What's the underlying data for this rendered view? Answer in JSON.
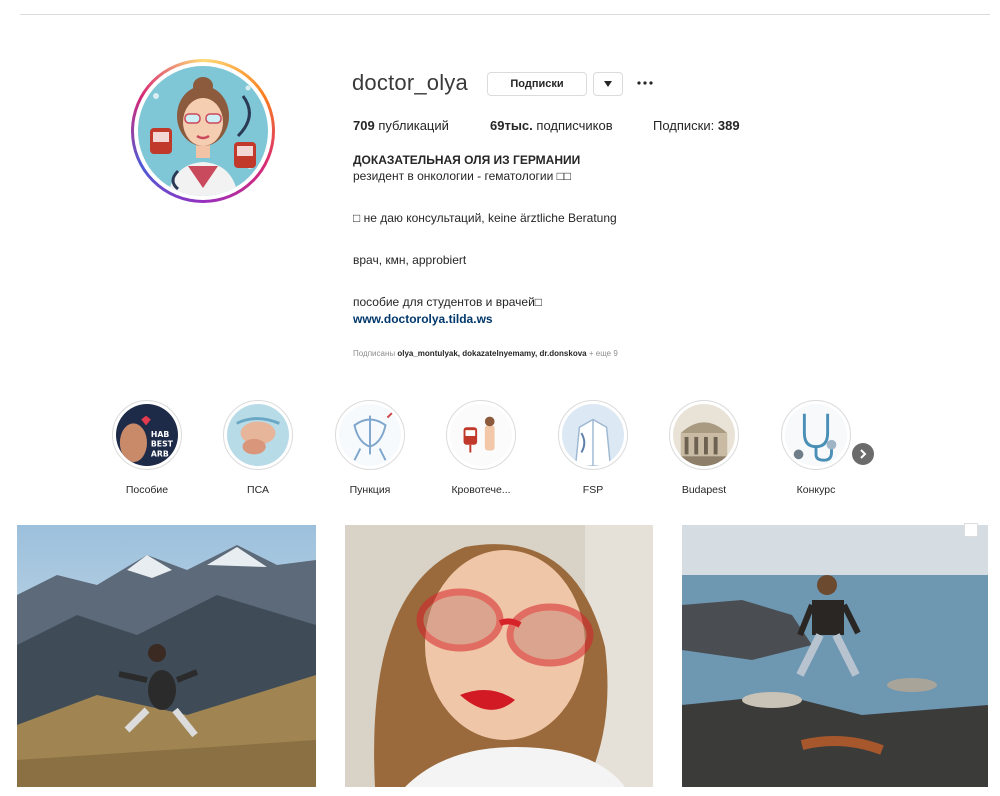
{
  "profile": {
    "username": "doctor_olya",
    "subscribed_button": "Подписки",
    "stats": {
      "posts_count": "709",
      "posts_label": "публикаций",
      "followers_count": "69тыс.",
      "followers_label": "подписчиков",
      "following_label": "Подписки:",
      "following_count": "389"
    },
    "bio": {
      "name": "ДОКАЗАТЕЛЬНАЯ ОЛЯ ИЗ ГЕРМАНИИ",
      "line1": "резидент в онкологии - гематологии □□",
      "line2": "□ не даю консультаций, keine ärztliche Beratung",
      "line3": "врач, кмн, approbiert",
      "line4": "пособие для студентов и врачей□",
      "link": "www.doctorolya.tilda.ws"
    },
    "followed_by": {
      "prefix": "Подписаны",
      "users": "olya_montulyak, dokazatelnyemamy, dr.donskova",
      "suffix": "+ еще 9"
    }
  },
  "highlights": [
    {
      "label": "Пособие",
      "icon": "book-cover-icon"
    },
    {
      "label": "ПСА",
      "icon": "anatomy-icon"
    },
    {
      "label": "Пункция",
      "icon": "pelvis-icon"
    },
    {
      "label": "Кровотече...",
      "icon": "blood-bag-icon"
    },
    {
      "label": "FSP",
      "icon": "doctor-coat-icon"
    },
    {
      "label": "Budapest",
      "icon": "building-icon"
    },
    {
      "label": "Конкурс",
      "icon": "stethoscope-icon"
    }
  ],
  "icons": {
    "dropdown": "caret-down-icon",
    "more": "ellipsis-icon",
    "next": "chevron-right-icon"
  },
  "colors": {
    "link": "#00376b",
    "border": "#dbdbdb",
    "muted": "#8e8e8e"
  }
}
